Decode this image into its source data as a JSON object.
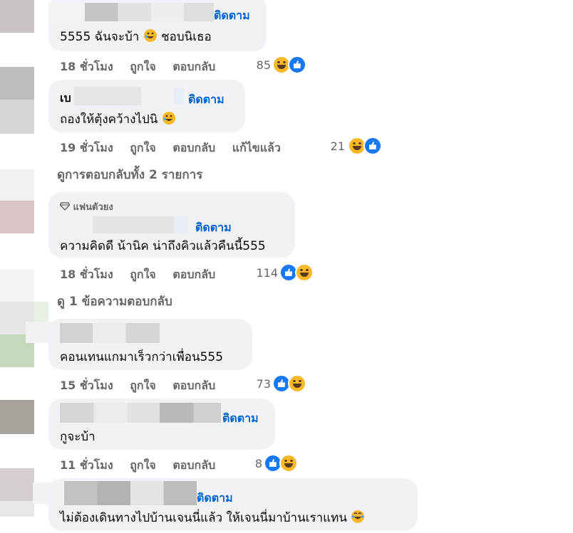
{
  "follow_label": "ติดตาม",
  "like_label": "ถูกใจ",
  "reply_label": "ตอบกลับ",
  "comments": [
    {
      "text": "5555 ฉันจะบ้า",
      "text_suffix": "ชอบนิเธอ",
      "time": "18 ชั่วโมง",
      "reaction_count": "85",
      "reactions": [
        "haha-icon",
        "like-icon"
      ]
    },
    {
      "name_partial": "เบ",
      "text": "ถองให้ตุ้งคว้างไปนิ",
      "time": "19 ชั่วโมง",
      "edited_label": "แก้ไขแล้ว",
      "reaction_count": "21",
      "reactions": [
        "haha-icon",
        "like-icon"
      ]
    },
    {
      "badge": "แฟนตัวยง",
      "text": "ความคิดดี น้านิค น่าถึงคิวแล้วคืนนี้555",
      "time": "18 ชั่วโมง",
      "reaction_count": "114",
      "reactions": [
        "like-icon",
        "haha-icon"
      ]
    },
    {
      "text": "คอนเทนแกมาเร็วกว่าเพื่อน555",
      "time": "15 ชั่วโมง",
      "reaction_count": "73",
      "reactions": [
        "like-icon",
        "haha-icon"
      ]
    },
    {
      "text": "กูจะบ้า",
      "time": "11 ชั่วโมง",
      "reaction_count": "8",
      "reactions": [
        "like-icon",
        "haha-icon"
      ]
    },
    {
      "text": "ไม่ต้องเดินทางไปบ้านเจนนี่แล้ว ให้เจนนี่มาบ้านเราแทน"
    }
  ],
  "view_replies": [
    {
      "label": "ดูการตอบกลับทั้ง 2 รายการ"
    },
    {
      "label": "ดู 1 ข้อความตอบกลับ"
    }
  ],
  "colors": {
    "bubble": "#f0f2f5",
    "link": "#0064d1",
    "meta": "#65676b",
    "like": "#1877f2",
    "haha": "#f7b928"
  }
}
